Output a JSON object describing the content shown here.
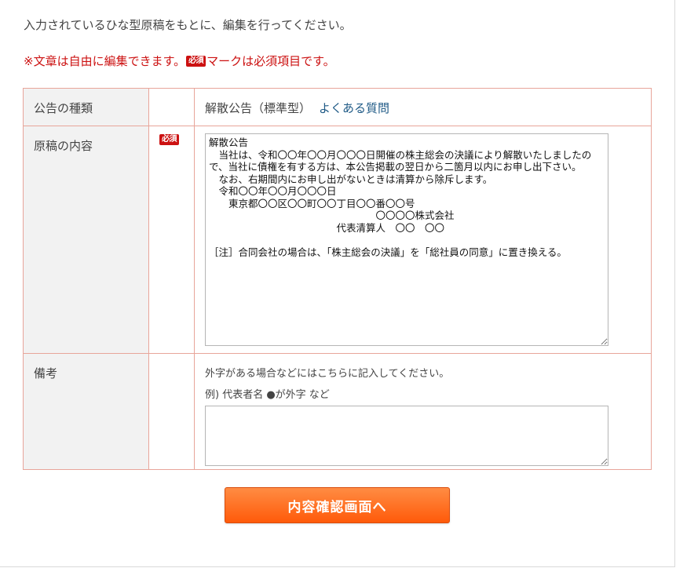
{
  "intro_text": "入力されているひな型原稿をもとに、編集を行ってください。",
  "notice": {
    "before_badge": "※文章は自由に編集できます。",
    "badge_label": "必須",
    "after_badge": "マークは必須項目です。"
  },
  "form": {
    "notice_type": {
      "label": "公告の種類",
      "value": "解散公告（標準型）",
      "faq_link": "よくある質問"
    },
    "content": {
      "label": "原稿の内容",
      "required_badge": "必須",
      "text": "解散公告\n　当社は、令和〇〇年〇〇月〇〇〇日開催の株主総会の決議により解散いたしましたので、当社に債権を有する方は、本公告掲載の翌日から二箇月以内にお申し出下さい。\n　なお、右期間内にお申し出がないときは清算から除斥します。\n　令和〇〇年〇〇月〇〇〇日\n　　東京都〇〇区〇〇町〇〇丁目〇〇番〇〇号\n　　　　　　　　　　　　　　　　　〇〇〇〇株式会社\n　　　　　　　　　　　　　代表清算人　〇〇　〇〇\n\n［注］合同会社の場合は、「株主総会の決議」を「総社員の同意」に置き換える。"
    },
    "notes": {
      "label": "備考",
      "help_text": "外字がある場合などにはこちらに記入してください。",
      "example_text": "例) 代表者名 ●が外字 など",
      "value": ""
    }
  },
  "confirm_button_label": "内容確認画面へ",
  "colors": {
    "notice_red": "#cc1111",
    "table_border": "#e8a59a",
    "label_background": "#f2f2f2",
    "link_blue": "#1f5a86",
    "button_orange": "#ff6a1a"
  }
}
